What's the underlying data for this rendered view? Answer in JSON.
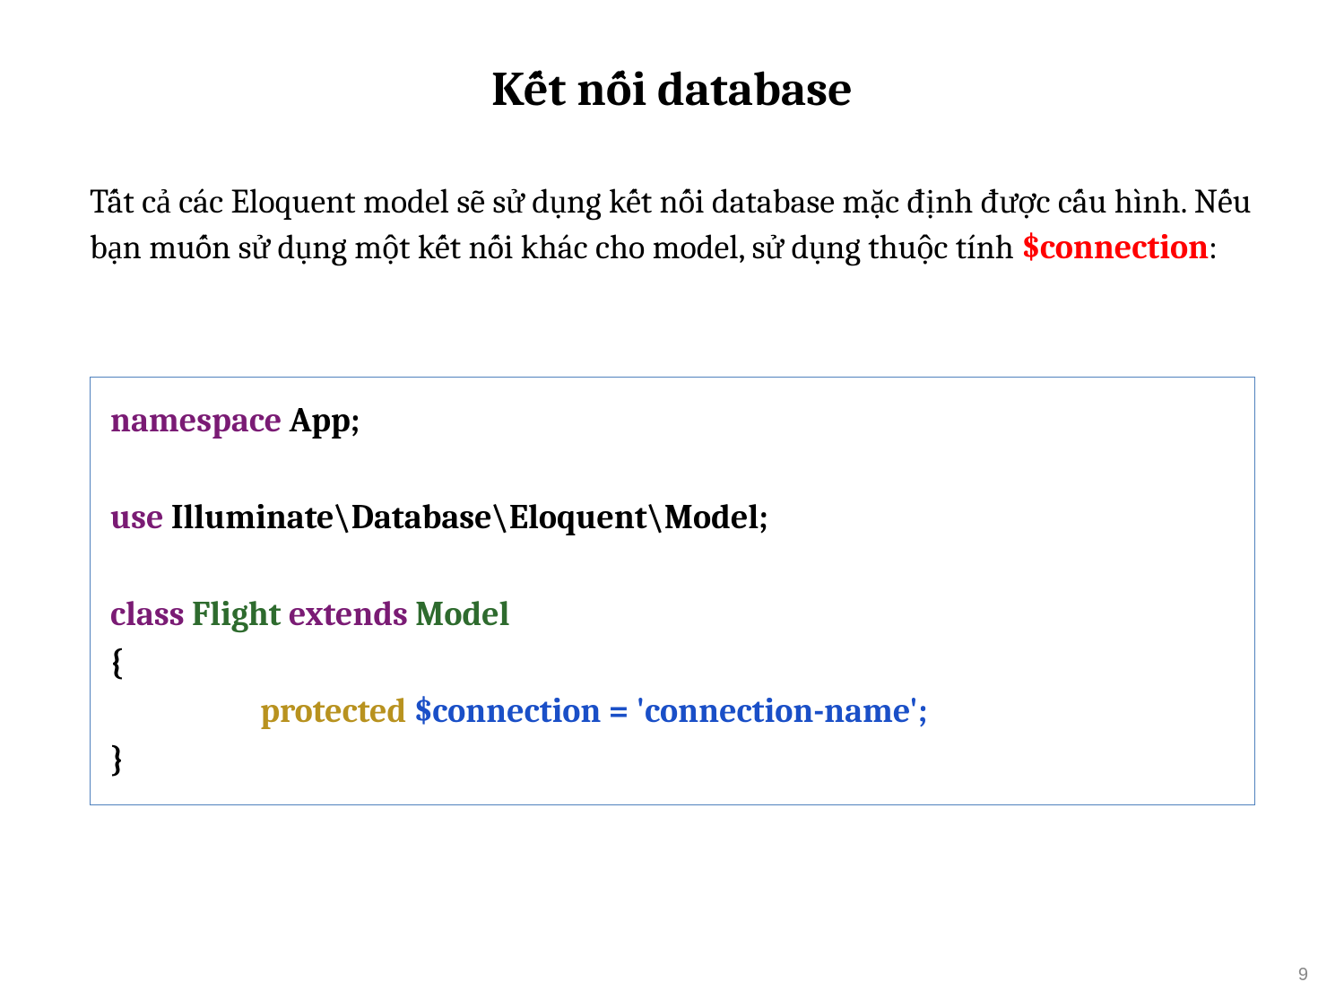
{
  "title": "Kết nối database",
  "paragraph": {
    "pre": "Tất cả các Eloquent model sẽ sử dụng kết nối database mặc định được cấu hình. Nếu bạn muốn sử dụng một kết nối khác cho model, sử dụng thuộc tính ",
    "highlight": "$connection",
    "post": ":"
  },
  "code": {
    "namespace_kw": "namespace",
    "namespace_name": " App;",
    "use_kw": "use",
    "use_name": " Illuminate\\Database\\Eloquent\\Model;",
    "class_kw": "class",
    "class_name": " Flight ",
    "extends_kw": "extends",
    "model_name": " Model",
    "open_brace": "{",
    "protected_kw": "protected",
    "var_name": " $connection ",
    "equals": "= ",
    "string": "'connection-name'",
    "semi": ";",
    "close_brace": "}"
  },
  "page_number": "9"
}
